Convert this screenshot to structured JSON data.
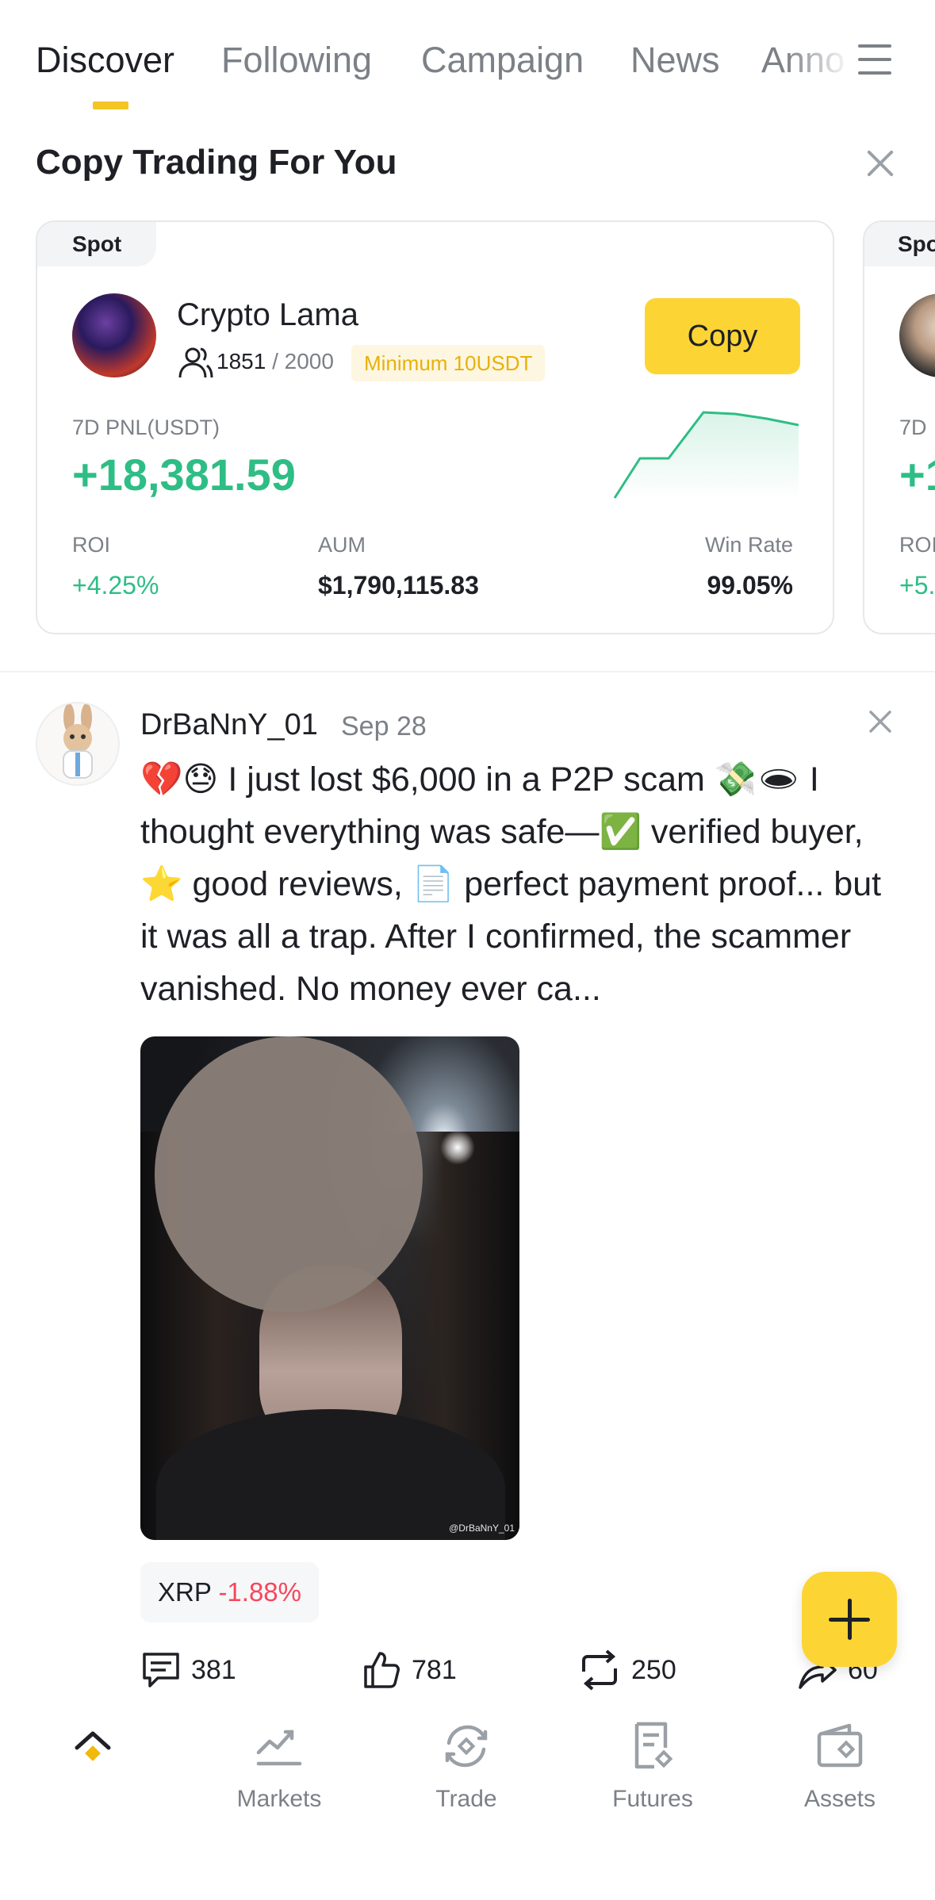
{
  "tabs": [
    {
      "label": "Discover",
      "active": true
    },
    {
      "label": "Following",
      "active": false
    },
    {
      "label": "Campaign",
      "active": false
    },
    {
      "label": "News",
      "active": false
    },
    {
      "label": "Anno",
      "active": false
    }
  ],
  "copy_trading": {
    "title": "Copy Trading For You",
    "card": {
      "tag": "Spot",
      "trader_name": "Crypto Lama",
      "followers": "1851",
      "followers_max": "/ 2000",
      "minimum": "Minimum 10USDT",
      "copy_label": "Copy",
      "pnl_label": "7D PNL(USDT)",
      "pnl_value": "+18,381.59",
      "roi_label": "ROI",
      "roi_value": "+4.25%",
      "aum_label": "AUM",
      "aum_value": "$1,790,115.83",
      "winrate_label": "Win Rate",
      "winrate_value": "99.05%"
    },
    "peek_card": {
      "tag": "Spo",
      "pnl_label": "7D",
      "pnl_value": "+1",
      "roi_label": "ROI",
      "roi_value": "+5."
    }
  },
  "post": {
    "author": "DrBaNnY_01",
    "date": "Sep 28",
    "text": "💔😓 I just lost $6,000 in a P2P scam 💸🕳 I thought everything was safe—✅ verified buyer, ⭐ good reviews, 📄 perfect payment proof... but it was all a trap. After I confirmed, the scammer vanished. No money ever ca...",
    "image_watermark": "@DrBaNnY_01",
    "coin": "XRP",
    "coin_change": "-1.88%",
    "comments": "381",
    "likes": "781",
    "reposts": "250",
    "shares": "60"
  },
  "bottom_nav": {
    "home_label": "",
    "markets_label": "Markets",
    "trade_label": "Trade",
    "futures_label": "Futures",
    "assets_label": "Assets"
  },
  "colors": {
    "accent": "#fcd535",
    "positive": "#2ebd85",
    "negative": "#f6465d",
    "muted": "#7c8087"
  }
}
